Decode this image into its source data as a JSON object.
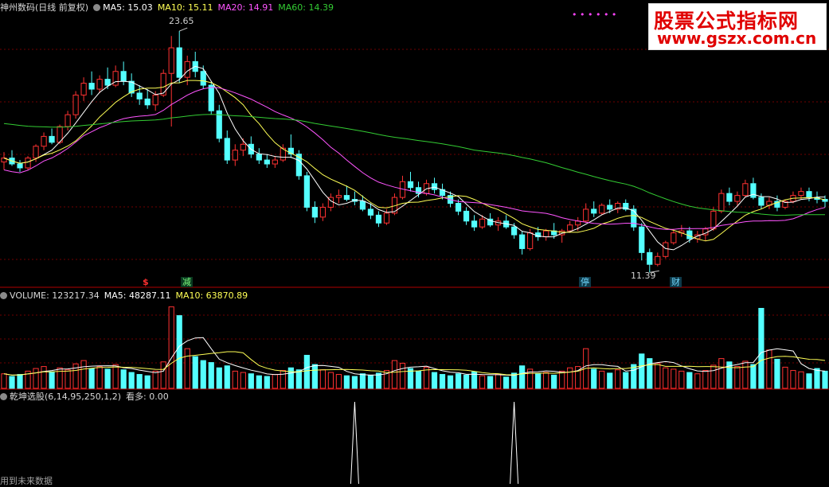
{
  "header": {
    "title": "神州数码(日线 前复权)",
    "ma5": "MA5: 15.03",
    "ma10": "MA10: 15.11",
    "ma20": "MA20: 14.91",
    "ma60": "MA60: 14.39",
    "dots": "• • • • • •"
  },
  "volume_header": {
    "title": "VOLUME: 123217.34",
    "ma5": "MA5: 48287.11",
    "ma10": "MA10: 63870.89"
  },
  "indicator_header": {
    "title": "乾坤选股(6,14,95,250,1,2)",
    "value": "看多: 0.00"
  },
  "watermark": {
    "line1": "股票公式指标网",
    "line2": "www.gszx.com.cn"
  },
  "markers": {
    "dollar": "$",
    "reduce": "减",
    "stop": "停",
    "finance": "财"
  },
  "labels": {
    "high": "23.65",
    "low": "11.39"
  },
  "footer": "用到未来数据",
  "colors": {
    "up": "#ff3232",
    "down": "#54ffff",
    "ma5": "#ffffff",
    "ma10": "#ffff55",
    "ma20": "#ff55ff",
    "ma60": "#33cc33",
    "separator": "#b00000"
  },
  "chart_data": [
    {
      "type": "candlestick",
      "title": "神州数码(日线 前复权)",
      "y_range": [
        11.0,
        24.5
      ],
      "annotations": {
        "max": 23.65,
        "min": 11.39
      },
      "series": [
        {
          "name": "MA5",
          "last": 15.03
        },
        {
          "name": "MA10",
          "last": 15.11
        },
        {
          "name": "MA20",
          "last": 14.91
        },
        {
          "name": "MA60",
          "last": 14.39
        }
      ],
      "ohlc": [
        [
          17.0,
          17.5,
          16.6,
          17.2
        ],
        [
          17.2,
          17.6,
          16.8,
          16.9
        ],
        [
          16.9,
          17.1,
          16.5,
          16.7
        ],
        [
          16.7,
          17.3,
          16.6,
          17.2
        ],
        [
          17.2,
          17.9,
          17.0,
          17.8
        ],
        [
          17.8,
          18.5,
          17.6,
          18.3
        ],
        [
          18.3,
          18.7,
          17.9,
          18.0
        ],
        [
          18.0,
          18.9,
          17.9,
          18.8
        ],
        [
          18.8,
          19.6,
          18.6,
          19.4
        ],
        [
          19.4,
          20.6,
          19.2,
          20.4
        ],
        [
          20.4,
          21.3,
          20.1,
          21.0
        ],
        [
          21.0,
          21.6,
          20.4,
          20.7
        ],
        [
          20.7,
          21.4,
          20.5,
          21.2
        ],
        [
          21.2,
          21.8,
          20.7,
          20.9
        ],
        [
          20.9,
          21.9,
          20.8,
          21.6
        ],
        [
          21.6,
          22.1,
          20.9,
          21.1
        ],
        [
          21.1,
          21.5,
          20.3,
          20.5
        ],
        [
          20.5,
          20.9,
          19.9,
          20.2
        ],
        [
          20.2,
          20.7,
          19.7,
          19.9
        ],
        [
          19.9,
          20.6,
          19.6,
          20.4
        ],
        [
          20.4,
          21.7,
          20.3,
          21.5
        ],
        [
          21.5,
          23.4,
          18.8,
          22.8
        ],
        [
          22.8,
          23.65,
          21.0,
          21.3
        ],
        [
          21.3,
          22.4,
          20.9,
          22.1
        ],
        [
          22.1,
          22.6,
          21.3,
          21.6
        ],
        [
          21.6,
          21.9,
          20.7,
          20.9
        ],
        [
          20.9,
          21.1,
          19.4,
          19.6
        ],
        [
          19.6,
          19.9,
          18.0,
          18.2
        ],
        [
          18.2,
          18.6,
          16.9,
          17.1
        ],
        [
          17.1,
          17.9,
          16.8,
          17.6
        ],
        [
          17.6,
          18.2,
          17.3,
          17.9
        ],
        [
          17.9,
          18.3,
          17.2,
          17.4
        ],
        [
          17.4,
          17.7,
          16.9,
          17.1
        ],
        [
          17.1,
          17.4,
          16.7,
          16.9
        ],
        [
          16.9,
          17.3,
          16.7,
          17.1
        ],
        [
          17.1,
          17.9,
          17.0,
          17.7
        ],
        [
          17.7,
          18.4,
          17.2,
          17.4
        ],
        [
          17.4,
          17.6,
          16.1,
          16.3
        ],
        [
          16.3,
          16.5,
          14.5,
          14.7
        ],
        [
          14.7,
          15.0,
          13.9,
          14.2
        ],
        [
          14.2,
          14.9,
          14.0,
          14.7
        ],
        [
          14.7,
          15.4,
          14.5,
          15.2
        ],
        [
          15.2,
          15.6,
          14.9,
          15.3
        ],
        [
          15.3,
          15.8,
          15.0,
          15.1
        ],
        [
          15.1,
          15.5,
          14.8,
          15.0
        ],
        [
          15.0,
          15.3,
          14.5,
          14.6
        ],
        [
          14.6,
          14.9,
          14.1,
          14.3
        ],
        [
          14.3,
          14.5,
          13.7,
          13.9
        ],
        [
          13.9,
          14.6,
          13.8,
          14.4
        ],
        [
          14.4,
          15.4,
          14.3,
          15.2
        ],
        [
          15.2,
          16.3,
          15.1,
          16.0
        ],
        [
          16.0,
          16.5,
          15.5,
          15.7
        ],
        [
          15.7,
          16.0,
          15.2,
          15.4
        ],
        [
          15.4,
          16.1,
          15.3,
          15.9
        ],
        [
          15.9,
          16.2,
          15.4,
          15.6
        ],
        [
          15.6,
          15.9,
          15.1,
          15.3
        ],
        [
          15.3,
          15.5,
          14.7,
          14.9
        ],
        [
          14.9,
          15.1,
          14.3,
          14.5
        ],
        [
          14.5,
          14.7,
          13.8,
          14.0
        ],
        [
          14.0,
          14.3,
          13.5,
          13.7
        ],
        [
          13.7,
          14.3,
          13.6,
          14.1
        ],
        [
          14.1,
          14.4,
          13.7,
          13.8
        ],
        [
          13.8,
          14.2,
          13.5,
          14.0
        ],
        [
          14.0,
          14.3,
          13.6,
          13.7
        ],
        [
          13.7,
          13.9,
          13.1,
          13.3
        ],
        [
          13.3,
          13.5,
          12.3,
          12.6
        ],
        [
          12.6,
          13.6,
          12.5,
          13.4
        ],
        [
          13.4,
          13.7,
          13.0,
          13.2
        ],
        [
          13.2,
          13.6,
          13.0,
          13.5
        ],
        [
          13.5,
          13.9,
          13.1,
          13.3
        ],
        [
          13.3,
          13.6,
          12.9,
          13.5
        ],
        [
          13.5,
          14.0,
          13.4,
          13.8
        ],
        [
          13.8,
          14.2,
          13.5,
          14.0
        ],
        [
          14.0,
          14.9,
          13.9,
          14.6
        ],
        [
          14.6,
          15.0,
          14.2,
          14.4
        ],
        [
          14.4,
          14.9,
          14.3,
          14.8
        ],
        [
          14.8,
          15.1,
          14.4,
          14.6
        ],
        [
          14.6,
          15.0,
          14.4,
          14.9
        ],
        [
          14.9,
          15.1,
          14.5,
          14.6
        ],
        [
          14.6,
          14.8,
          13.5,
          13.7
        ],
        [
          13.7,
          13.9,
          12.0,
          12.4
        ],
        [
          12.4,
          12.6,
          11.39,
          11.8
        ],
        [
          11.8,
          12.4,
          11.7,
          12.2
        ],
        [
          12.2,
          13.0,
          12.1,
          12.9
        ],
        [
          12.9,
          13.6,
          12.8,
          13.4
        ],
        [
          13.4,
          13.8,
          13.2,
          13.5
        ],
        [
          13.5,
          13.7,
          12.9,
          13.1
        ],
        [
          13.1,
          13.5,
          12.9,
          13.3
        ],
        [
          13.3,
          13.7,
          13.0,
          13.6
        ],
        [
          13.6,
          14.7,
          13.5,
          14.5
        ],
        [
          14.5,
          15.6,
          14.4,
          15.4
        ],
        [
          15.4,
          15.7,
          14.8,
          15.0
        ],
        [
          15.0,
          15.5,
          14.8,
          15.3
        ],
        [
          15.3,
          16.1,
          15.2,
          15.9
        ],
        [
          15.9,
          16.2,
          15.1,
          15.2
        ],
        [
          15.2,
          15.4,
          14.6,
          14.8
        ],
        [
          14.8,
          15.2,
          14.6,
          15.0
        ],
        [
          15.0,
          15.3,
          14.5,
          14.7
        ],
        [
          14.7,
          15.1,
          14.6,
          15.0
        ],
        [
          15.0,
          15.5,
          14.9,
          15.3
        ],
        [
          15.3,
          15.7,
          15.1,
          15.5
        ],
        [
          15.5,
          15.7,
          15.0,
          15.2
        ],
        [
          15.2,
          15.5,
          14.9,
          15.1
        ],
        [
          15.1,
          15.3,
          14.7,
          15.0
        ]
      ]
    },
    {
      "type": "bar",
      "title": "VOLUME",
      "series": [
        {
          "name": "VOLUME",
          "last": 123217.34
        },
        {
          "name": "MA5",
          "last": 48287.11
        },
        {
          "name": "MA10",
          "last": 63870.89
        }
      ],
      "y_range": [
        0,
        130000
      ],
      "values": [
        22000,
        18000,
        21000,
        26000,
        30000,
        33000,
        25000,
        31000,
        28000,
        37000,
        42000,
        30000,
        33000,
        29000,
        36000,
        28000,
        24000,
        21000,
        19000,
        26000,
        40000,
        123217,
        110000,
        60000,
        48000,
        42000,
        39000,
        31000,
        34000,
        26000,
        24000,
        22000,
        19000,
        18000,
        21000,
        27000,
        31000,
        28000,
        50000,
        36000,
        28000,
        24000,
        21000,
        19000,
        18000,
        22000,
        20000,
        23000,
        27000,
        42000,
        38000,
        30000,
        26000,
        32000,
        24000,
        21000,
        19000,
        22000,
        20000,
        25000,
        19000,
        18000,
        21000,
        17000,
        23000,
        34000,
        29000,
        22000,
        24000,
        20000,
        26000,
        31000,
        33000,
        60000,
        29000,
        26000,
        23000,
        28000,
        24000,
        36000,
        52000,
        45000,
        38000,
        31000,
        29000,
        26000,
        24000,
        22000,
        27000,
        35000,
        45000,
        40000,
        33000,
        41000,
        36000,
        121000,
        58000,
        44000,
        32000,
        27000,
        25000,
        22000,
        30000,
        26000
      ]
    },
    {
      "type": "line",
      "title": "乾坤选股(6,14,95,250,1,2)",
      "series": [
        {
          "name": "看多",
          "last": 0.0
        }
      ],
      "signals_at_index": [
        44,
        64
      ]
    }
  ]
}
